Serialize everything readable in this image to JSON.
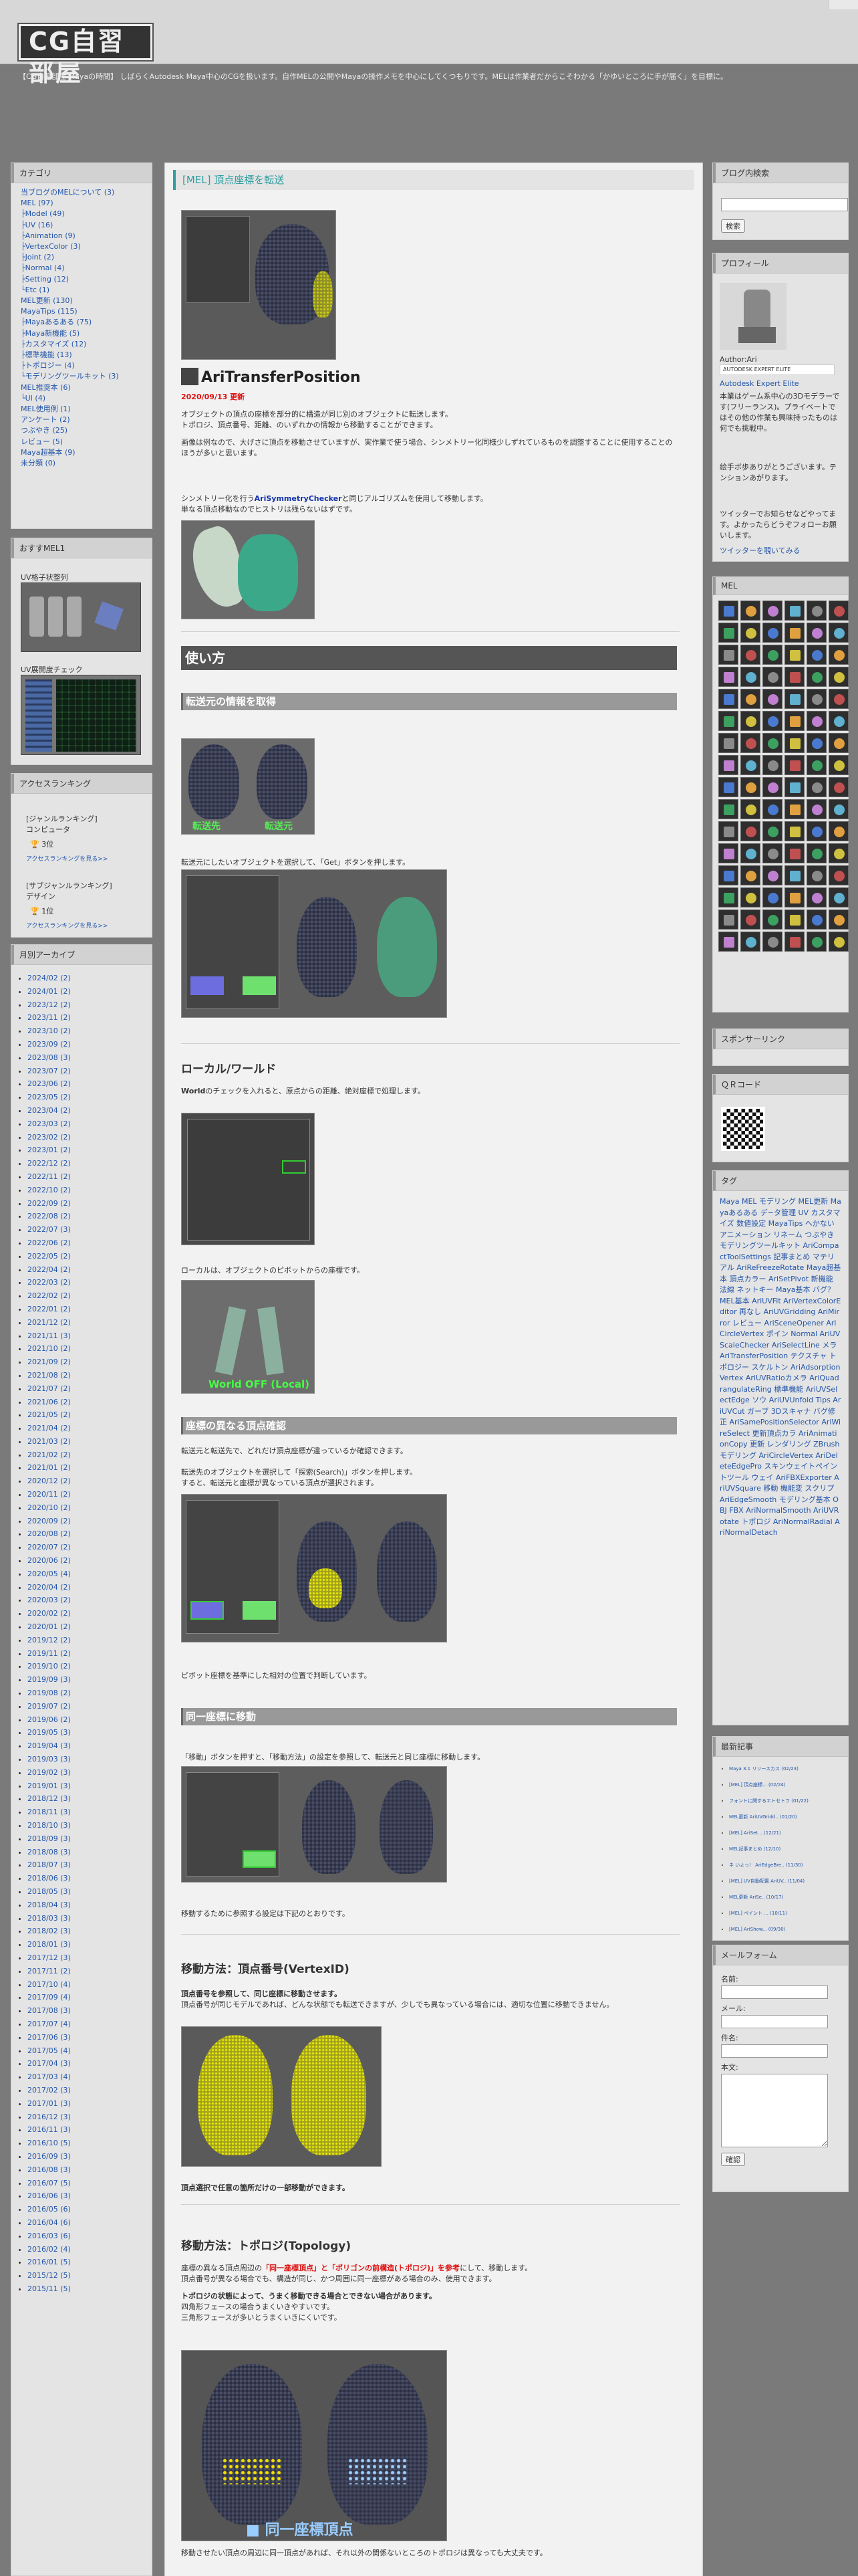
{
  "site": {
    "logo": "CG自習部屋",
    "tagline": "【CG自習部屋 Mayaの時間】 しばらくAutodesk Maya中心のCGを扱います。自作MELの公開やMayaの操作メモを中心にしてくつもりです。MELは作業者だからこそわかる「かゆいところに手が届く」を目標に。"
  },
  "left": {
    "category": {
      "title": "カテゴリ",
      "items": [
        "当ブログのMELについて (3)",
        "MEL (97)",
        "├Model (49)",
        "├UV (16)",
        "├Animation (9)",
        "├VertexColor (3)",
        "├Joint (2)",
        "├Normal (4)",
        "├Setting (12)",
        "└Etc (1)",
        "MEL更新 (130)",
        "MayaTips (115)",
        "├Mayaあるある (75)",
        "├Maya新機能 (5)",
        "├カスタマイズ (12)",
        "├標準機能 (13)",
        "├トポロジー (4)",
        "└モデリングツールキット (3)",
        "MEL推奨本 (6)",
        "└UI (4)",
        "MEL使用例 (1)",
        "アンケート (2)",
        "つぶやき (25)",
        "レビュー (5)",
        "Maya超基本 (9)",
        "未分類 (0)"
      ]
    },
    "recommend": {
      "title": "おすすMEL1",
      "item1": "UV格子状整列",
      "item2": "UV展開度チェック"
    },
    "ranking": {
      "title": "アクセスランキング",
      "r1_head": "[ジャンルランキング]",
      "r1_genre": "コンピュータ",
      "r1_rank": "3位",
      "r1_link": "アクセスランキングを見る>>",
      "r2_head": "[サブジャンルランキング]",
      "r2_genre": "デザイン",
      "r2_rank": "1位",
      "r2_link": "アクセスランキングを見る>>"
    },
    "archive": {
      "title": "月別アーカイブ",
      "items": [
        "2024/02 (2)",
        "2024/01 (2)",
        "2023/12 (2)",
        "2023/11 (2)",
        "2023/10 (2)",
        "2023/09 (2)",
        "2023/08 (3)",
        "2023/07 (2)",
        "2023/06 (2)",
        "2023/05 (2)",
        "2023/04 (2)",
        "2023/03 (2)",
        "2023/02 (2)",
        "2023/01 (2)",
        "2022/12 (2)",
        "2022/11 (2)",
        "2022/10 (2)",
        "2022/09 (2)",
        "2022/08 (2)",
        "2022/07 (3)",
        "2022/06 (2)",
        "2022/05 (2)",
        "2022/04 (2)",
        "2022/03 (2)",
        "2022/02 (2)",
        "2022/01 (2)",
        "2021/12 (2)",
        "2021/11 (3)",
        "2021/10 (2)",
        "2021/09 (2)",
        "2021/08 (2)",
        "2021/07 (2)",
        "2021/06 (2)",
        "2021/05 (2)",
        "2021/04 (2)",
        "2021/03 (2)",
        "2021/02 (2)",
        "2021/01 (2)",
        "2020/12 (2)",
        "2020/11 (2)",
        "2020/10 (2)",
        "2020/09 (2)",
        "2020/08 (2)",
        "2020/07 (2)",
        "2020/06 (2)",
        "2020/05 (4)",
        "2020/04 (2)",
        "2020/03 (2)",
        "2020/02 (2)",
        "2020/01 (2)",
        "2019/12 (2)",
        "2019/11 (2)",
        "2019/10 (2)",
        "2019/09 (3)",
        "2019/08 (2)",
        "2019/07 (2)",
        "2019/06 (2)",
        "2019/05 (3)",
        "2019/04 (3)",
        "2019/03 (3)",
        "2019/02 (3)",
        "2019/01 (3)",
        "2018/12 (3)",
        "2018/11 (3)",
        "2018/10 (3)",
        "2018/09 (3)",
        "2018/08 (3)",
        "2018/07 (3)",
        "2018/06 (3)",
        "2018/05 (3)",
        "2018/04 (3)",
        "2018/03 (3)",
        "2018/02 (3)",
        "2018/01 (3)",
        "2017/12 (3)",
        "2017/11 (2)",
        "2017/10 (4)",
        "2017/09 (4)",
        "2017/08 (3)",
        "2017/07 (4)",
        "2017/06 (3)",
        "2017/05 (4)",
        "2017/04 (3)",
        "2017/03 (4)",
        "2017/02 (3)",
        "2017/01 (3)",
        "2016/12 (3)",
        "2016/11 (3)",
        "2016/10 (5)",
        "2016/09 (3)",
        "2016/08 (3)",
        "2016/07 (5)",
        "2016/06 (3)",
        "2016/05 (6)",
        "2016/04 (6)",
        "2016/03 (6)",
        "2016/02 (4)",
        "2016/01 (5)",
        "2015/12 (5)",
        "2015/11 (5)"
      ]
    }
  },
  "article": {
    "title": "[MEL] 頂点座標を転送",
    "mel_name": "AriTransferPosition",
    "date": "2020/09/13 更新",
    "intro1": "オブジェクトの頂点の座標を部分的に構造が同じ別のオブジェクトに転送します。",
    "intro2": "トポロジ、頂点番号、距離、のいずれかの情報から移動することができます。",
    "intro3": "画像は例なので、大げさに頂点を移動させていますが、実作業で使う場合、シンメトリー化同様少しずれているものを調整することに使用することのほうが多いと思います。",
    "intro4_pre": "シンメトリー化を行う",
    "intro4_link": "AriSymmetryChecker",
    "intro4_post": "と同じアルゴリズムを使用して移動します。",
    "intro5": "単なる頂点移動なのでヒストリは残らないはずです。",
    "h_usage": "使い方",
    "h_get": "転送元の情報を取得",
    "get_label_left": "転送先",
    "get_label_right": "転送元",
    "get_text": "転送元にしたいオブジェクトを選択して、「Get」ボタンを押します。",
    "h_local": "ローカル/ワールド",
    "local_text_b": "World",
    "local_text": "のチェックを入れると、原点からの距離、絶対座標で処理します。",
    "local_text2": "ローカルは、オブジェクトのピボットからの座標です。",
    "local_caption": "World OFF (Local)",
    "h_diff": "座標の異なる頂点確認",
    "diff_text1": "転送元と転送先で、どれだけ頂点座標が違っているか確認できます。",
    "diff_text2": "転送先のオブジェクトを選択して「探索(Search)」ボタンを押します。",
    "diff_text3": "すると、転送元と座標が異なっている頂点が選択されます。",
    "diff_text4": "ピボット座標を基準にした相対の位置で判断しています。",
    "h_same": "同一座標に移動",
    "same_text_pre": "「移動」ボタンを押すと、「移動方法」の設定を参照して、転送元と同じ座標に移動します。",
    "same_text2": "移動するために参照する設定は下記のとおりです。",
    "h_vertex": "移動方法：頂点番号(VertexID)",
    "vertex_text1": "頂点番号を参照して、同じ座標に移動させます。",
    "vertex_text2": "頂点番号が同じモデルであれば、どんな状態でも転送できますが、少しでも異なっている場合には、適切な位置に移動できません。",
    "vertex_text3": "頂点選択で任意の箇所だけの一部移動ができます。",
    "h_topo": "移動方法：トポロジ(Topology)",
    "topo_text1_pre": "座標の異なる頂点周辺の",
    "topo_text1_red": "「同一座標頂点」と「ポリゴンの前構造(トポロジ)」を参考",
    "topo_text1_post": "にして、移動します。",
    "topo_text2": "頂点番号が異なる場合でも、構造が同じ、かつ周囲に同一座標がある場合のみ、使用できます。",
    "topo_text3": "トポロジの状態によって、うまく移動できる場合とできない場合があります。",
    "topo_text4": "四角形フェースの場合うまくいきやすいです。",
    "topo_text5": "三角形フェースが多いとうまくいきにくいです。",
    "topo_caption": "■ 同一座標頂点",
    "topo_text6": "移動させたい頂点の周辺に同一頂点があれば、それ以外の関係ないところのトポロジは異なっても大丈夫です。"
  },
  "right": {
    "search": {
      "title": "ブログ内検索",
      "button": "検索"
    },
    "profile": {
      "title": "プロフィール",
      "author": "Author:Ari",
      "badge": "AUTODESK  EXPERT ELITE",
      "expert": "Autodesk Expert Elite",
      "bio": "本業はゲーム系中心の3Dモデラーです(フリーランス)。プライベートではその他の作業も興味持ったものは何でも挑戦中。",
      "bio2": "絵手ボ歩ありがとうございます。テンションあがります。",
      "bio3": "ツイッターでお知らせなどやってます。よかったらどうぞフォローお願いします。",
      "twitter": "ツイッターを覗いてみる"
    },
    "mel": {
      "title": "MEL"
    },
    "sponsor": {
      "title": "スポンサーリンク"
    },
    "qr": {
      "title": "ＱＲコード"
    },
    "tags": {
      "title": "タグ",
      "text": "Maya MEL モデリング MEL更新 Mayaあるある デ−タ管理 UV カスタマイズ 数値設定 MayaTips へかない アニメーション リネーム つぶやき モデリングツールキット AriCompactToolSettings 記事まとめ マテリアル AriReFreezeRotate Maya超基本 頂点カラー AriSetPivot 新機能 法線 ネットキー Maya基本 バグ？ MEL基本 AriUVFit AriVertexColorEditor 再なし AriUVGridding AriMirror レビュー AriSceneOpener AriCircleVertex ポイン Normal AriUVScaleChecker AriSelectLine メラ AriTransferPosition テクスチャ トポロジー スケルトン AriAdsorptionVertex AriUVRatioカメラ AriQuadrangulateRing 標準機能 AriUVSelectEdge ソウ AriUVUnfold Tips AriUVCut ガーブ 3Dスキャナ バグ修正 AriSamePositionSelector AriWireSelect 更新頂点カラ AriAnimationCopy 更新 レンダリング ZBrush モデリング AriCircleVertex AriDeleteEdgePro スキンウェイトペイントツール ウェイ AriFBXExporter AriUVSquare 移動 機能変 スクリプ AriEdgeSmooth モデリング基本 OBJ FBX AriNormalSmooth AriUVRotate トポロジ AriNormalRadial AriNormalDetach"
    },
    "recent": {
      "title": "最新記事",
      "items": [
        "Maya 3.1 リリースカス (02/23)",
        "[MEL] 頂点座標... (02/24)",
        "フォントに関するエトセトラ (01/22)",
        "MEL更新 AriUVGridd.. (01/20)",
        "[MEL] AriSet... (12/21)",
        "MEL記事まとめ (12/10)",
        "ネ いよっ！ AriEdgeBre.. (11/30)",
        "[MEL] UV自動配置 AriUV.. (11/04)",
        "MEL更新 AriSe.. (10/17)",
        "[MEL] ペイント ... (10/11)",
        "[MEL] AriShow... (09/30)"
      ]
    },
    "mail": {
      "title": "メールフォーム",
      "name": "名前:",
      "mail": "メール:",
      "subject": "件名:",
      "body": "本文:",
      "confirm": "確認"
    }
  }
}
